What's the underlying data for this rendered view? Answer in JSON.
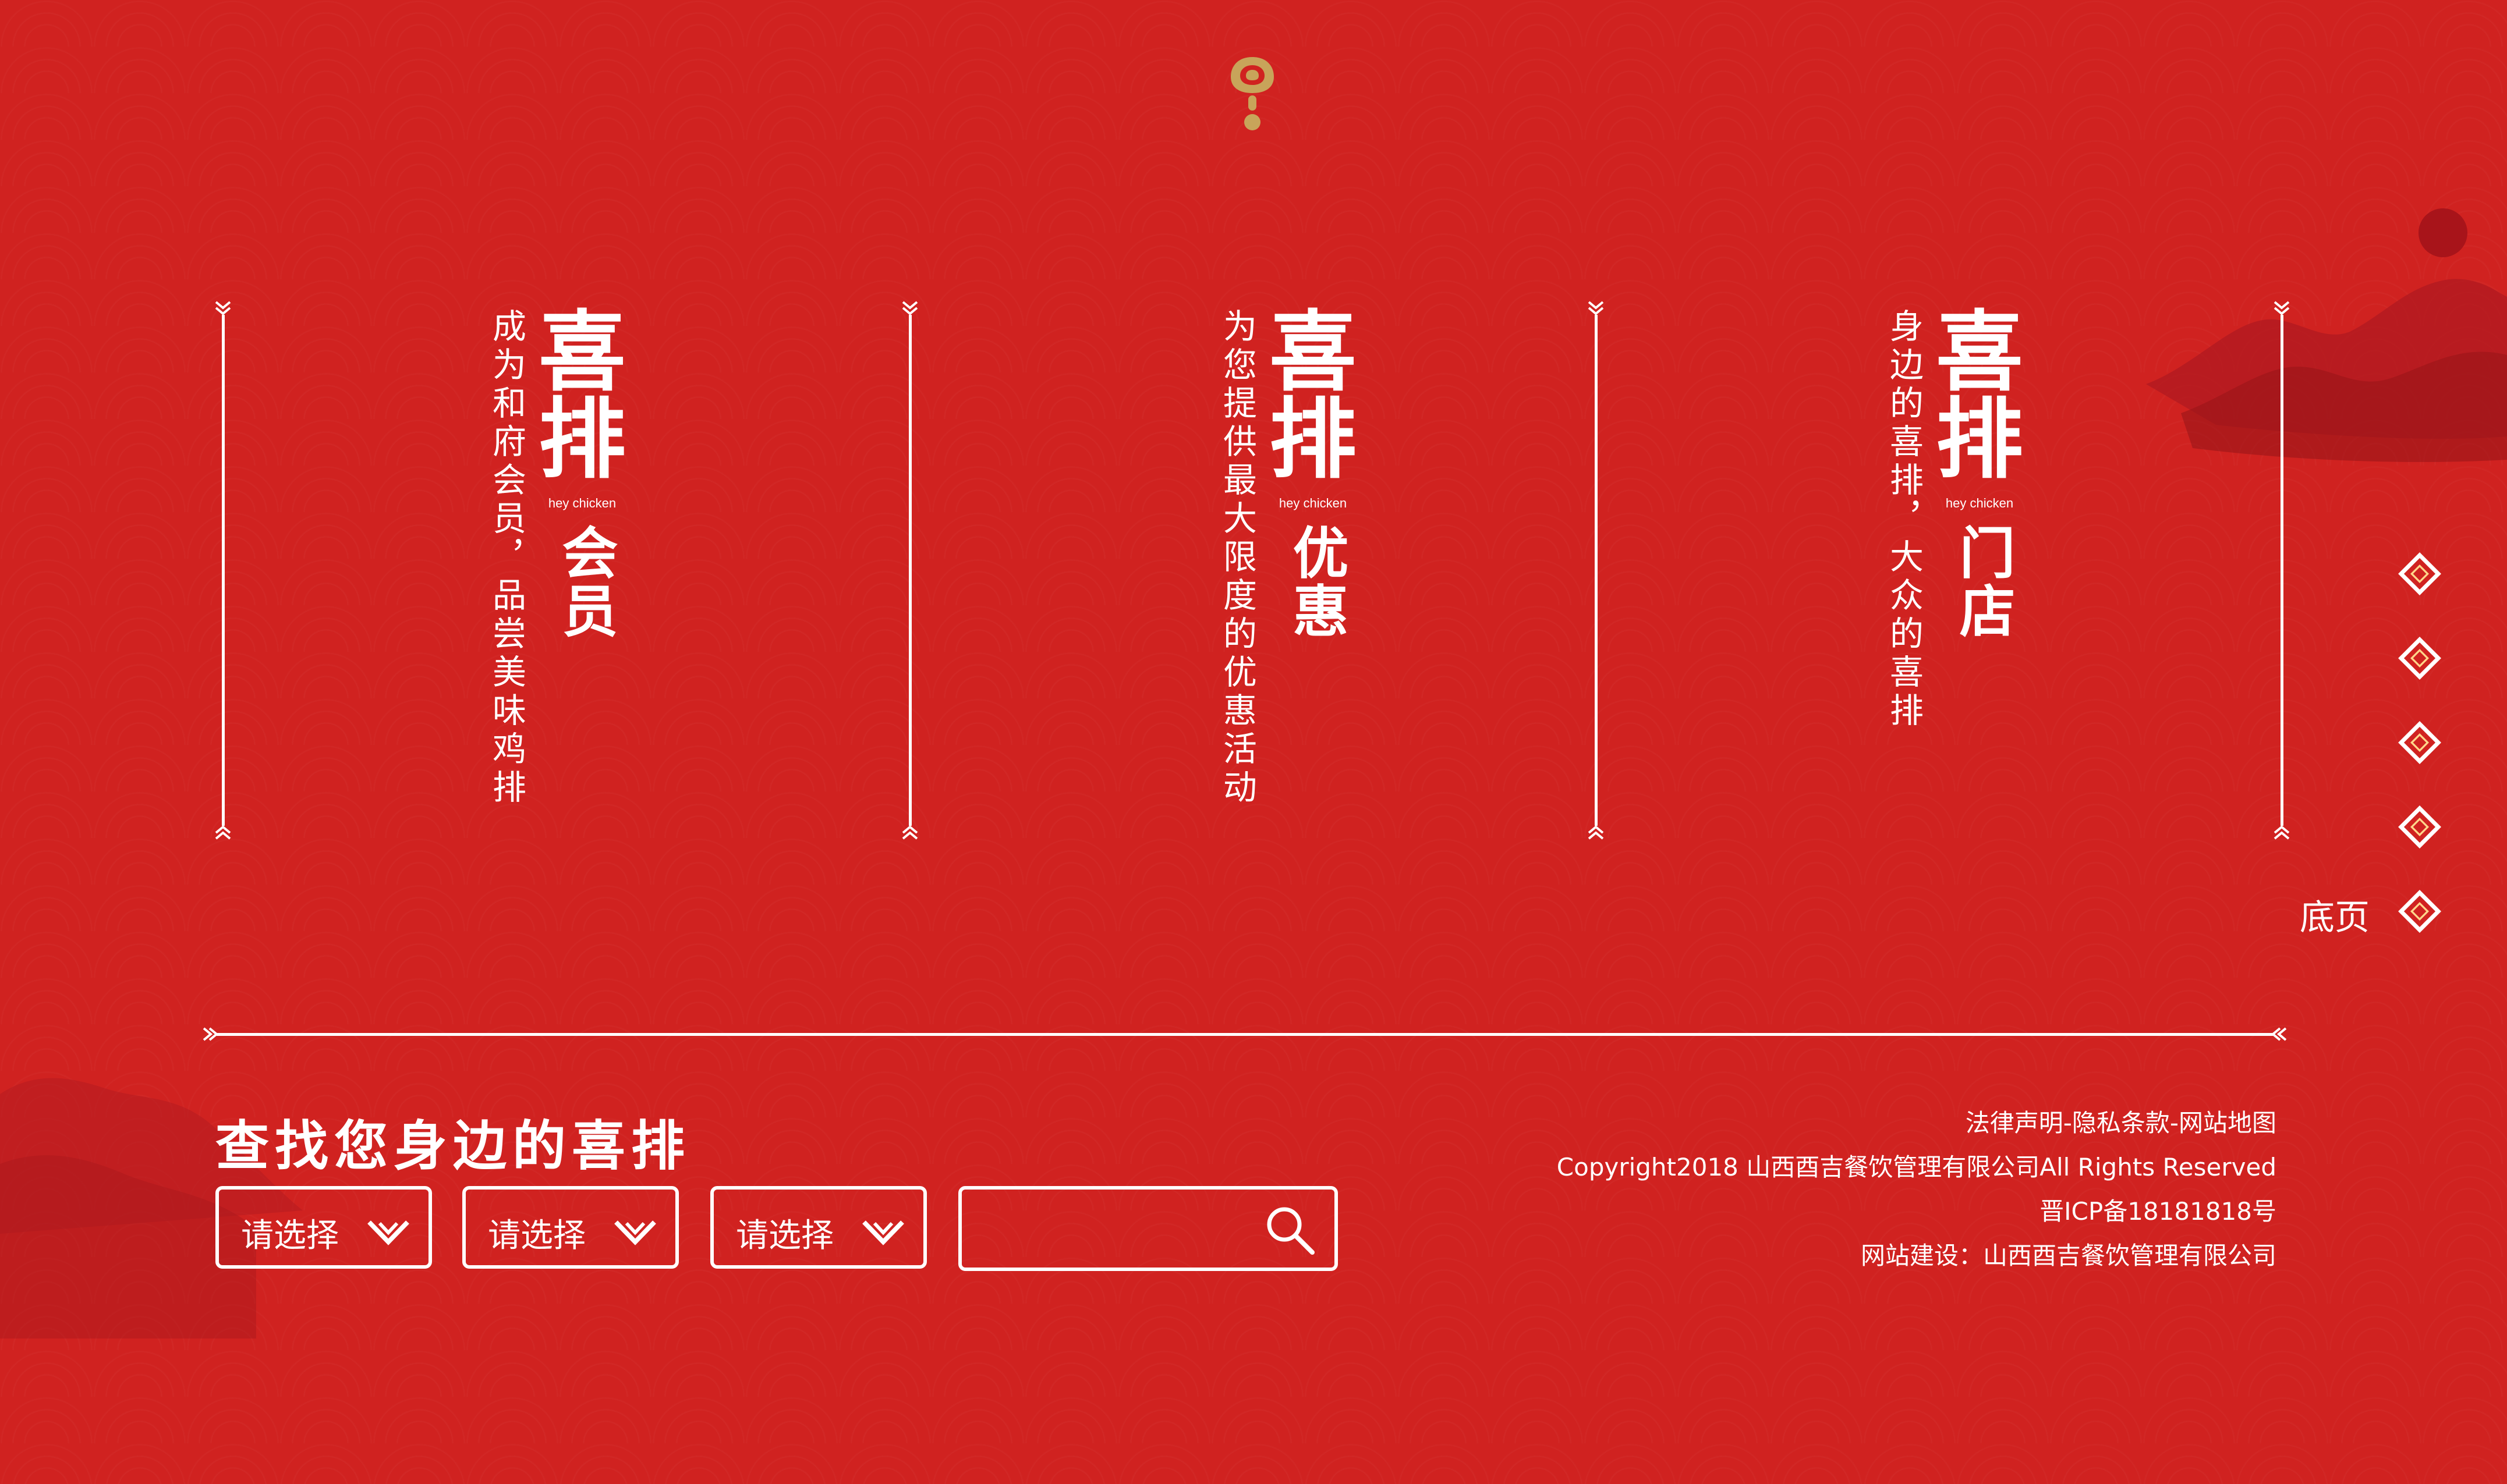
{
  "colors": {
    "background": "#d02220",
    "gold": "#c8a45a",
    "white": "#ffffff"
  },
  "panels": [
    {
      "id": "member",
      "description": "成为和府会员，品尝美味鸡排",
      "brand_top": "喜",
      "brand_bottom": "排",
      "brand_sub": "hey chicken",
      "title": "会员"
    },
    {
      "id": "offers",
      "description": "为您提供最大限度的优惠活动",
      "brand_top": "喜",
      "brand_bottom": "排",
      "brand_sub": "hey chicken",
      "title": "优惠"
    },
    {
      "id": "stores",
      "description": "身边的喜排，大众的喜排",
      "brand_top": "喜",
      "brand_bottom": "排",
      "brand_sub": "hey chicken",
      "title": "门店"
    }
  ],
  "side_nav": {
    "last_label": "底页",
    "icon": "diamond-icon"
  },
  "search": {
    "title": "查找您身边的喜排",
    "selects": [
      {
        "label": "请选择"
      },
      {
        "label": "请选择"
      },
      {
        "label": "请选择"
      }
    ],
    "input_value": "",
    "input_placeholder": ""
  },
  "footer": {
    "links": "法律声明-隐私条款-网站地图",
    "copyright": "Copyright2018 山西酉吉餐饮管理有限公司All Rights Reserved",
    "icp": "晋ICP备18181818号",
    "built_by": "网站建设：山西酉吉餐饮管理有限公司"
  }
}
